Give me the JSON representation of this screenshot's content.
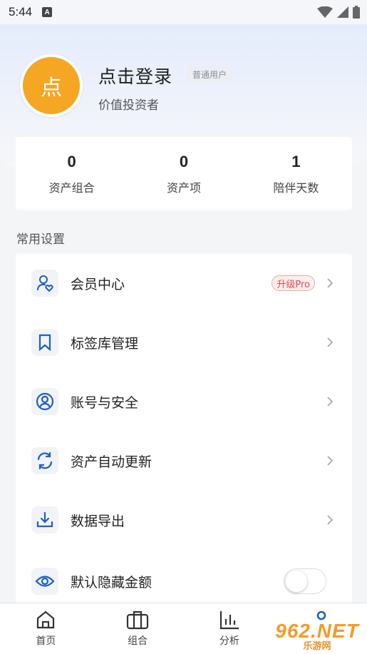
{
  "status_bar": {
    "time": "5:44",
    "notif_icon": "A"
  },
  "profile": {
    "avatar_text": "点",
    "title": "点击登录",
    "badge": "普通用户",
    "subtitle": "价值投资者"
  },
  "stats": [
    {
      "value": "0",
      "label": "资产组合"
    },
    {
      "value": "0",
      "label": "资产项"
    },
    {
      "value": "1",
      "label": "陪伴天数"
    }
  ],
  "section_title": "常用设置",
  "settings": [
    {
      "icon": "member-icon",
      "label": "会员中心",
      "badge": "升级Pro"
    },
    {
      "icon": "bookmark-icon",
      "label": "标签库管理"
    },
    {
      "icon": "account-icon",
      "label": "账号与安全"
    },
    {
      "icon": "refresh-icon",
      "label": "资产自动更新"
    },
    {
      "icon": "download-icon",
      "label": "数据导出"
    },
    {
      "icon": "eye-icon",
      "label": "默认隐藏金额",
      "toggle": false
    }
  ],
  "nav": [
    {
      "icon": "home-icon",
      "label": "首页"
    },
    {
      "icon": "portfolio-icon",
      "label": "组合"
    },
    {
      "icon": "chart-icon",
      "label": "分析"
    },
    {
      "icon": "profile-icon",
      "label": ""
    }
  ],
  "watermark": {
    "logo": "962.NET",
    "sub": "乐游网"
  },
  "colors": {
    "accent": "#1f5fbf",
    "avatar": "#f5a623",
    "pro": "#e14a4a"
  }
}
